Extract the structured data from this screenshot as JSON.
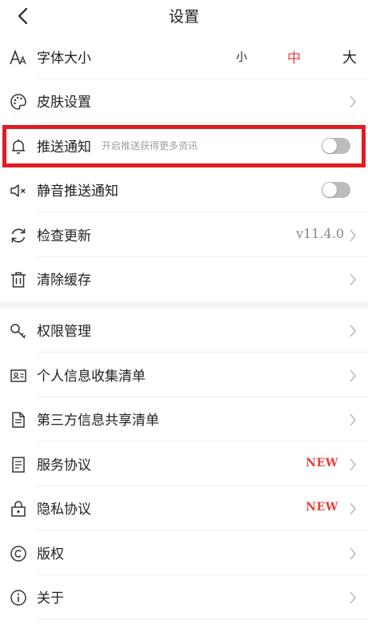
{
  "header": {
    "title": "设置"
  },
  "font_size": {
    "label": "字体大小",
    "options": [
      "小",
      "中",
      "大"
    ],
    "selected": "中"
  },
  "skin": {
    "label": "皮肤设置"
  },
  "push": {
    "label": "推送通知",
    "sublabel": "开启推送获得更多资讯",
    "enabled": false
  },
  "silent_push": {
    "label": "静音推送通知",
    "enabled": false
  },
  "update": {
    "label": "检查更新",
    "version": "v11.4.0"
  },
  "cache": {
    "label": "清除缓存"
  },
  "permission": {
    "label": "权限管理"
  },
  "personal_info": {
    "label": "个人信息收集清单"
  },
  "third_party": {
    "label": "第三方信息共享清单"
  },
  "service": {
    "label": "服务协议",
    "badge": "NEW"
  },
  "privacy": {
    "label": "隐私协议",
    "badge": "NEW"
  },
  "copyright": {
    "label": "版权"
  },
  "about": {
    "label": "关于"
  },
  "colors": {
    "accent": "#e8403c",
    "highlight": "#e21b22",
    "toggle_off": "#bcbcbc"
  }
}
